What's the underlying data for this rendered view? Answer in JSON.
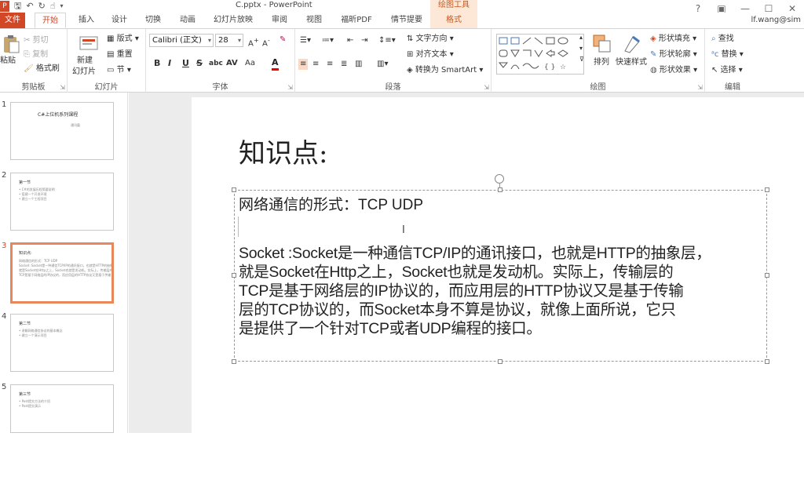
{
  "window": {
    "title": "C.pptx - PowerPoint",
    "context_tab_group": "绘图工具",
    "user": "lf.wang@sim"
  },
  "tabs": [
    "文件",
    "开始",
    "插入",
    "设计",
    "切换",
    "动画",
    "幻灯片放映",
    "审阅",
    "视图",
    "福昕PDF",
    "情节提要",
    "格式"
  ],
  "ribbon": {
    "clipboard": {
      "label": "剪贴板",
      "paste": "粘贴",
      "cut": "剪切",
      "copy": "复制",
      "format_painter": "格式刷"
    },
    "slides": {
      "label": "幻灯片",
      "new_slide": "新建",
      "new_slide2": "幻灯片",
      "layout": "版式",
      "reset": "重置",
      "section": "节"
    },
    "font": {
      "label": "字体",
      "font_name": "Calibri (正文)",
      "font_size": "28",
      "bold": "B",
      "italic": "I",
      "underline": "U",
      "strike": "S",
      "shadow": "abc",
      "spacing": "AV",
      "case": "Aa",
      "font_color": "A"
    },
    "paragraph": {
      "label": "段落",
      "text_direction": "文字方向",
      "align_text": "对齐文本",
      "smartart": "转换为 SmartArt"
    },
    "drawing": {
      "label": "绘图",
      "arrange": "排列",
      "quick_styles": "快速样式",
      "shape_fill": "形状填充",
      "shape_outline": "形状轮廓",
      "shape_effects": "形状效果"
    },
    "editing": {
      "label": "编辑",
      "find": "查找",
      "replace": "替换",
      "select": "选择"
    }
  },
  "thumbnails": [
    {
      "num": "1",
      "title": "C#上位机系列课程",
      "lines": [
        "通讯篇"
      ]
    },
    {
      "num": "2",
      "title": "第一节",
      "lines": [
        "• C#的发展历程简要说明",
        "• 搭建一个开发环境",
        "• 建立一个工程项目"
      ]
    },
    {
      "num": "3",
      "title": "知识点:",
      "lines": [
        "网络通信的形式：TCP UDP",
        "Socket :Socket是一种通信TCP/IP的通讯接口，也就是HTTP的抽象层",
        "就是Socket在Http之上，Socket也就是发动机。实际上，传输层的",
        "TCP是基于网络层的IP协议的，而应用层的HTTP协议又是基于传输"
      ]
    },
    {
      "num": "4",
      "title": "第二节",
      "lines": [
        "• 讲解网络通信协议的基本概念",
        "• 建立一个演示项目"
      ]
    },
    {
      "num": "5",
      "title": "第三节",
      "lines": [
        "• Post提交方法的介绍",
        "• Post提交演示"
      ]
    }
  ],
  "slide": {
    "title": "知识点:",
    "line1": "网络通信的形式：TCP  UDP",
    "paragraph": [
      "Socket :Socket是一种通信TCP/IP的通讯接口，也就是HTTP的抽象层，",
      "就是Socket在Http之上，Socket也就是发动机。实际上，传输层的",
      "TCP是基于网络层的IP协议的，而应用层的HTTP协议又是基于传输",
      "层的TCP协议的，而Socket本身不算是协议，就像上面所说，它只",
      "是提供了一个针对TCP或者UDP编程的接口。"
    ]
  },
  "colors": {
    "accent": "#d24726",
    "context": "#fde8d8",
    "selection": "#e8875a"
  }
}
